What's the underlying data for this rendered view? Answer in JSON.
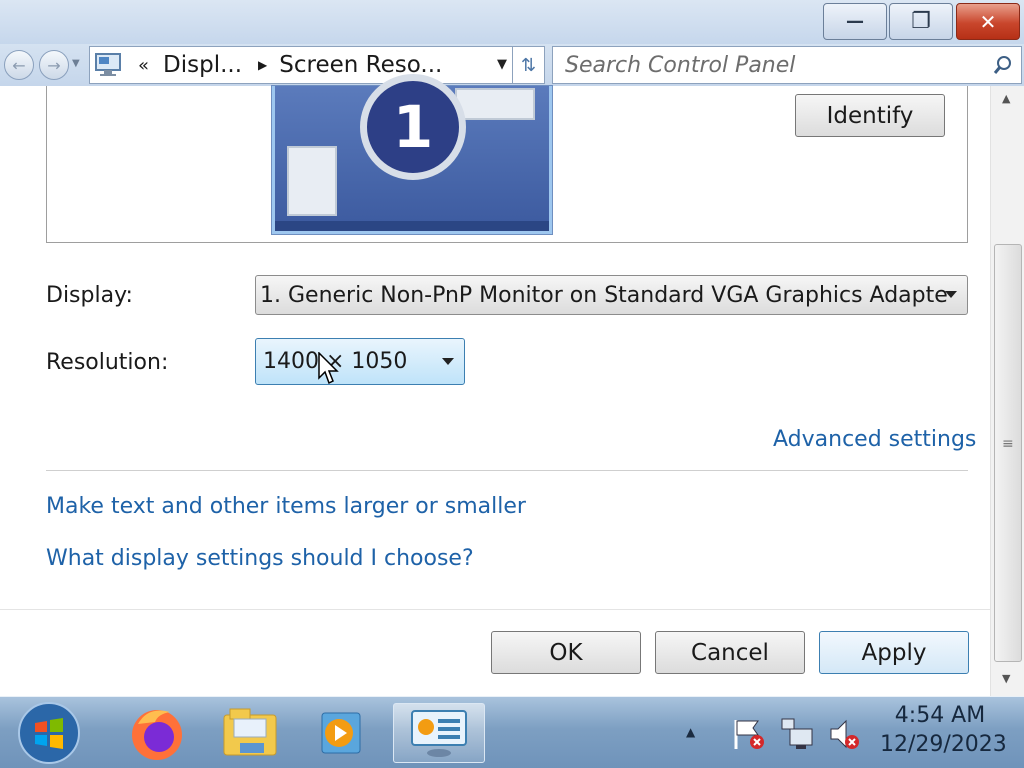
{
  "window": {
    "caption_buttons": {
      "minimize": "—",
      "maximize": "❐",
      "close": "✕"
    }
  },
  "address_bar": {
    "overflow": "«",
    "crumbs": [
      "Displ...",
      "Screen Reso..."
    ],
    "search_placeholder": "Search Control Panel"
  },
  "preview": {
    "monitor_number": "1",
    "identify_label": "Identify"
  },
  "settings": {
    "display_label": "Display:",
    "display_value": "1. Generic Non-PnP Monitor on Standard VGA Graphics Adapte",
    "resolution_label": "Resolution:",
    "resolution_value": "1400 × 1050",
    "advanced_link": "Advanced settings"
  },
  "help_links": {
    "text_size": "Make text and other items larger or smaller",
    "which_settings": "What display settings should I choose?"
  },
  "buttons": {
    "ok": "OK",
    "cancel": "Cancel",
    "apply": "Apply"
  },
  "taskbar": {
    "clock_time": "4:54 AM",
    "clock_date": "12/29/2023",
    "icons": [
      "start-orb-icon",
      "firefox-icon",
      "file-explorer-icon",
      "media-player-icon",
      "control-panel-icon"
    ],
    "tray_icons": [
      "show-hidden-icons-icon",
      "action-center-flag-icon",
      "network-icon",
      "volume-muted-icon"
    ]
  },
  "colors": {
    "link": "#1e62a8",
    "title_bar": "#c6d7ec",
    "close_button": "#c9462c",
    "taskbar": "#7d9fc2",
    "monitor": "#3c5a9f"
  }
}
